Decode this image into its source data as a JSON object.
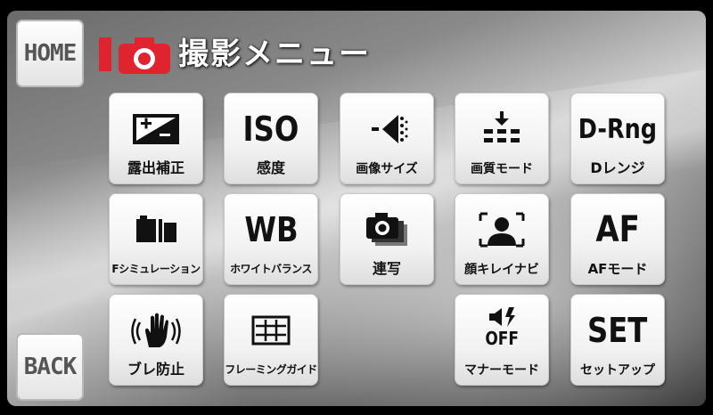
{
  "header": {
    "home_label": "HOME",
    "title": "撮影メニュー",
    "title_icon": "camera-icon",
    "accent_color": "#e0242f"
  },
  "footer": {
    "back_label": "BACK"
  },
  "menu": {
    "exposure": {
      "label": "露出補正",
      "icon": "exposure-compensation-icon"
    },
    "iso": {
      "label": "感度",
      "icon_text": "ISO"
    },
    "image_size": {
      "label": "画像サイズ",
      "icon": "image-size-icon"
    },
    "image_quality": {
      "label": "画質モード",
      "icon": "image-quality-icon"
    },
    "drange": {
      "label": "Dレンジ",
      "icon_text": "D-Rng"
    },
    "film_sim": {
      "label": "Fシミュレーション",
      "icon": "film-simulation-icon"
    },
    "wb": {
      "label": "ホワイトバランス",
      "icon_text": "WB"
    },
    "burst": {
      "label": "連写",
      "icon": "continuous-shooting-icon"
    },
    "face": {
      "label": "顔キレイナビ",
      "icon": "face-detection-icon"
    },
    "af": {
      "label": "AFモード",
      "icon_text": "AF"
    },
    "stabilizer": {
      "label": "ブレ防止",
      "icon": "image-stabilizer-icon"
    },
    "frame_guide": {
      "label": "フレーミングガイド",
      "icon": "framing-guide-icon"
    },
    "silent": {
      "label": "マナーモード",
      "icon_text": "OFF"
    },
    "setup": {
      "label": "セットアップ",
      "icon_text": "SET"
    }
  }
}
